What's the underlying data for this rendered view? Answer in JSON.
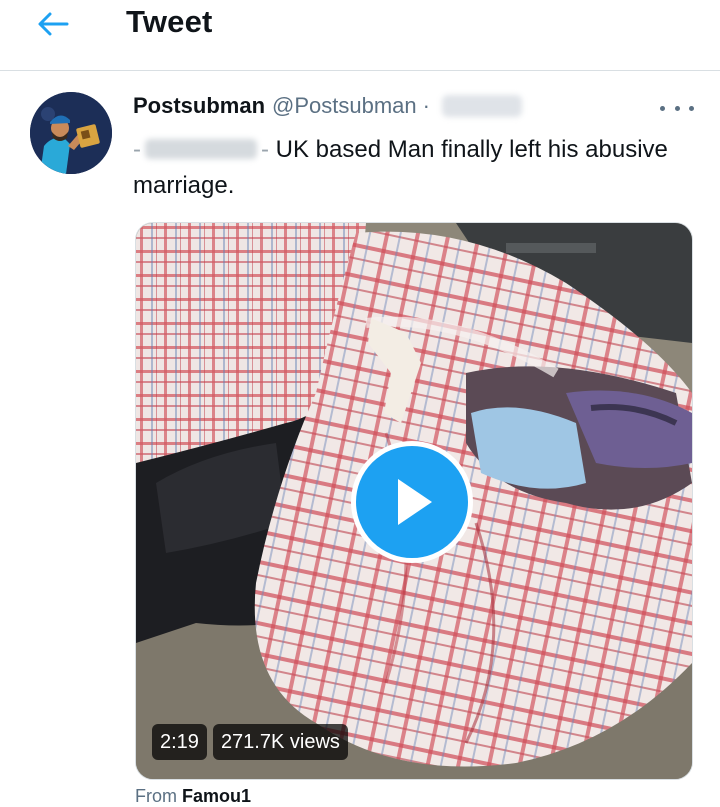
{
  "header": {
    "title": "Tweet",
    "back_icon": "arrow-left-icon",
    "accent": "#1da1f2"
  },
  "tweet": {
    "author_name": "Postsubman",
    "author_handle": "@Postsubman",
    "separator": "·",
    "text_prefix": "-",
    "text_dash": "-",
    "text_body": "UK based Man finally left his abusive marriage.",
    "more_icon": "more-horizontal-icon"
  },
  "media": {
    "duration": "2:19",
    "views": "271.7K views",
    "play_icon": "play-icon"
  },
  "source": {
    "label": "From",
    "account": "Famou1"
  }
}
